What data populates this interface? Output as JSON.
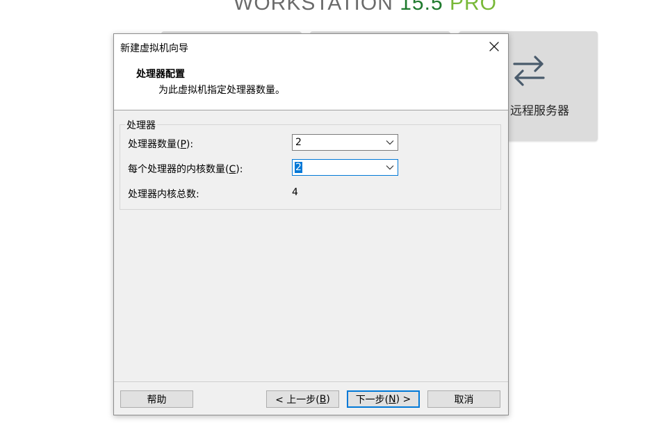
{
  "background": {
    "brand_workstation": "WORKSTATION",
    "brand_version": "15.5",
    "brand_pro": "PRO",
    "remote_server_label": "远程服务器",
    "remote_server_icon": "swap-arrows-icon"
  },
  "dialog": {
    "title": "新建虚拟机向导",
    "header_title": "处理器配置",
    "header_subtitle": "为此虚拟机指定处理器数量。",
    "group_label": "处理器",
    "processor_count": {
      "label_prefix": "处理器数量(",
      "mnemonic": "P",
      "label_suffix": "):",
      "value": "2"
    },
    "cores_per_processor": {
      "label_prefix": "每个处理器的内核数量(",
      "mnemonic": "C",
      "label_suffix": "):",
      "value": "2"
    },
    "total_cores": {
      "label": "处理器内核总数:",
      "value": "4"
    },
    "buttons": {
      "help": "帮助",
      "back_prefix": "< 上一步(",
      "back_mnemonic": "B",
      "back_suffix": ")",
      "next_prefix": "下一步(",
      "next_mnemonic": "N",
      "next_suffix": ") >",
      "cancel": "取消"
    }
  }
}
